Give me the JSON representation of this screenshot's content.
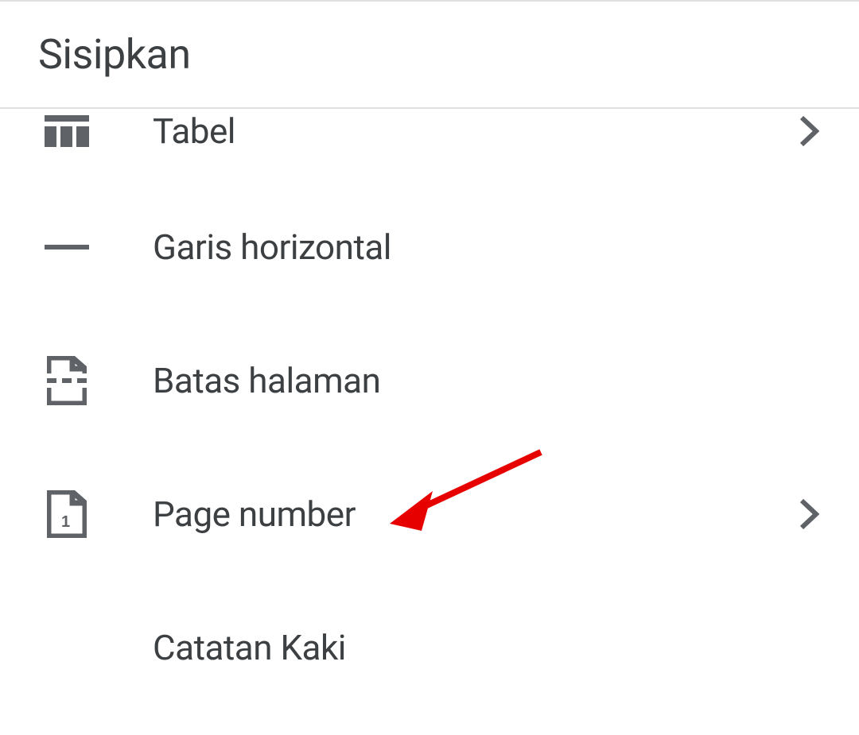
{
  "header": {
    "title": "Sisipkan"
  },
  "menu": [
    {
      "id": "table",
      "label": "Tabel",
      "icon": "table-icon",
      "has_chevron": true
    },
    {
      "id": "horizontal-line",
      "label": "Garis horizontal",
      "icon": "horizontal-line-icon",
      "has_chevron": false
    },
    {
      "id": "page-break",
      "label": "Batas halaman",
      "icon": "page-break-icon",
      "has_chevron": false
    },
    {
      "id": "page-number",
      "label": "Page number",
      "icon": "page-number-icon",
      "has_chevron": true
    },
    {
      "id": "footnote",
      "label": "Catatan Kaki",
      "icon": "footnote-icon",
      "has_chevron": false
    }
  ]
}
